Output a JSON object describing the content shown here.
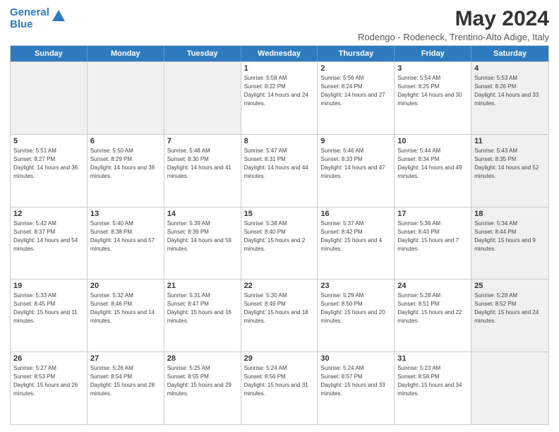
{
  "logo": {
    "line1": "General",
    "line2": "Blue"
  },
  "title": "May 2024",
  "subtitle": "Rodengo - Rodeneck, Trentino-Alto Adige, Italy",
  "days": [
    "Sunday",
    "Monday",
    "Tuesday",
    "Wednesday",
    "Thursday",
    "Friday",
    "Saturday"
  ],
  "weeks": [
    [
      {
        "day": "",
        "sunrise": "",
        "sunset": "",
        "daylight": "",
        "shaded": true
      },
      {
        "day": "",
        "sunrise": "",
        "sunset": "",
        "daylight": "",
        "shaded": true
      },
      {
        "day": "",
        "sunrise": "",
        "sunset": "",
        "daylight": "",
        "shaded": true
      },
      {
        "day": "1",
        "sunrise": "Sunrise: 5:58 AM",
        "sunset": "Sunset: 8:22 PM",
        "daylight": "Daylight: 14 hours and 24 minutes.",
        "shaded": false
      },
      {
        "day": "2",
        "sunrise": "Sunrise: 5:56 AM",
        "sunset": "Sunset: 8:24 PM",
        "daylight": "Daylight: 14 hours and 27 minutes.",
        "shaded": false
      },
      {
        "day": "3",
        "sunrise": "Sunrise: 5:54 AM",
        "sunset": "Sunset: 8:25 PM",
        "daylight": "Daylight: 14 hours and 30 minutes.",
        "shaded": false
      },
      {
        "day": "4",
        "sunrise": "Sunrise: 5:53 AM",
        "sunset": "Sunset: 8:26 PM",
        "daylight": "Daylight: 14 hours and 33 minutes.",
        "shaded": true
      }
    ],
    [
      {
        "day": "5",
        "sunrise": "Sunrise: 5:51 AM",
        "sunset": "Sunset: 8:27 PM",
        "daylight": "Daylight: 14 hours and 36 minutes.",
        "shaded": false
      },
      {
        "day": "6",
        "sunrise": "Sunrise: 5:50 AM",
        "sunset": "Sunset: 8:29 PM",
        "daylight": "Daylight: 14 hours and 38 minutes.",
        "shaded": false
      },
      {
        "day": "7",
        "sunrise": "Sunrise: 5:48 AM",
        "sunset": "Sunset: 8:30 PM",
        "daylight": "Daylight: 14 hours and 41 minutes.",
        "shaded": false
      },
      {
        "day": "8",
        "sunrise": "Sunrise: 5:47 AM",
        "sunset": "Sunset: 8:31 PM",
        "daylight": "Daylight: 14 hours and 44 minutes.",
        "shaded": false
      },
      {
        "day": "9",
        "sunrise": "Sunrise: 5:46 AM",
        "sunset": "Sunset: 8:33 PM",
        "daylight": "Daylight: 14 hours and 47 minutes.",
        "shaded": false
      },
      {
        "day": "10",
        "sunrise": "Sunrise: 5:44 AM",
        "sunset": "Sunset: 8:34 PM",
        "daylight": "Daylight: 14 hours and 49 minutes.",
        "shaded": false
      },
      {
        "day": "11",
        "sunrise": "Sunrise: 5:43 AM",
        "sunset": "Sunset: 8:35 PM",
        "daylight": "Daylight: 14 hours and 52 minutes.",
        "shaded": true
      }
    ],
    [
      {
        "day": "12",
        "sunrise": "Sunrise: 5:42 AM",
        "sunset": "Sunset: 8:37 PM",
        "daylight": "Daylight: 14 hours and 54 minutes.",
        "shaded": false
      },
      {
        "day": "13",
        "sunrise": "Sunrise: 5:40 AM",
        "sunset": "Sunset: 8:38 PM",
        "daylight": "Daylight: 14 hours and 57 minutes.",
        "shaded": false
      },
      {
        "day": "14",
        "sunrise": "Sunrise: 5:39 AM",
        "sunset": "Sunset: 8:39 PM",
        "daylight": "Daylight: 14 hours and 59 minutes.",
        "shaded": false
      },
      {
        "day": "15",
        "sunrise": "Sunrise: 5:38 AM",
        "sunset": "Sunset: 8:40 PM",
        "daylight": "Daylight: 15 hours and 2 minutes.",
        "shaded": false
      },
      {
        "day": "16",
        "sunrise": "Sunrise: 5:37 AM",
        "sunset": "Sunset: 8:42 PM",
        "daylight": "Daylight: 15 hours and 4 minutes.",
        "shaded": false
      },
      {
        "day": "17",
        "sunrise": "Sunrise: 5:36 AM",
        "sunset": "Sunset: 8:43 PM",
        "daylight": "Daylight: 15 hours and 7 minutes.",
        "shaded": false
      },
      {
        "day": "18",
        "sunrise": "Sunrise: 5:34 AM",
        "sunset": "Sunset: 8:44 PM",
        "daylight": "Daylight: 15 hours and 9 minutes.",
        "shaded": true
      }
    ],
    [
      {
        "day": "19",
        "sunrise": "Sunrise: 5:33 AM",
        "sunset": "Sunset: 8:45 PM",
        "daylight": "Daylight: 15 hours and 11 minutes.",
        "shaded": false
      },
      {
        "day": "20",
        "sunrise": "Sunrise: 5:32 AM",
        "sunset": "Sunset: 8:46 PM",
        "daylight": "Daylight: 15 hours and 14 minutes.",
        "shaded": false
      },
      {
        "day": "21",
        "sunrise": "Sunrise: 5:31 AM",
        "sunset": "Sunset: 8:47 PM",
        "daylight": "Daylight: 15 hours and 16 minutes.",
        "shaded": false
      },
      {
        "day": "22",
        "sunrise": "Sunrise: 5:30 AM",
        "sunset": "Sunset: 8:49 PM",
        "daylight": "Daylight: 15 hours and 18 minutes.",
        "shaded": false
      },
      {
        "day": "23",
        "sunrise": "Sunrise: 5:29 AM",
        "sunset": "Sunset: 8:50 PM",
        "daylight": "Daylight: 15 hours and 20 minutes.",
        "shaded": false
      },
      {
        "day": "24",
        "sunrise": "Sunrise: 5:28 AM",
        "sunset": "Sunset: 8:51 PM",
        "daylight": "Daylight: 15 hours and 22 minutes.",
        "shaded": false
      },
      {
        "day": "25",
        "sunrise": "Sunrise: 5:28 AM",
        "sunset": "Sunset: 8:52 PM",
        "daylight": "Daylight: 15 hours and 24 minutes.",
        "shaded": true
      }
    ],
    [
      {
        "day": "26",
        "sunrise": "Sunrise: 5:27 AM",
        "sunset": "Sunset: 8:53 PM",
        "daylight": "Daylight: 15 hours and 26 minutes.",
        "shaded": false
      },
      {
        "day": "27",
        "sunrise": "Sunrise: 5:26 AM",
        "sunset": "Sunset: 8:54 PM",
        "daylight": "Daylight: 15 hours and 28 minutes.",
        "shaded": false
      },
      {
        "day": "28",
        "sunrise": "Sunrise: 5:25 AM",
        "sunset": "Sunset: 8:55 PM",
        "daylight": "Daylight: 15 hours and 29 minutes.",
        "shaded": false
      },
      {
        "day": "29",
        "sunrise": "Sunrise: 5:24 AM",
        "sunset": "Sunset: 8:56 PM",
        "daylight": "Daylight: 15 hours and 31 minutes.",
        "shaded": false
      },
      {
        "day": "30",
        "sunrise": "Sunrise: 5:24 AM",
        "sunset": "Sunset: 8:57 PM",
        "daylight": "Daylight: 15 hours and 33 minutes.",
        "shaded": false
      },
      {
        "day": "31",
        "sunrise": "Sunrise: 5:23 AM",
        "sunset": "Sunset: 8:58 PM",
        "daylight": "Daylight: 15 hours and 34 minutes.",
        "shaded": false
      },
      {
        "day": "",
        "sunrise": "",
        "sunset": "",
        "daylight": "",
        "shaded": true
      }
    ]
  ]
}
